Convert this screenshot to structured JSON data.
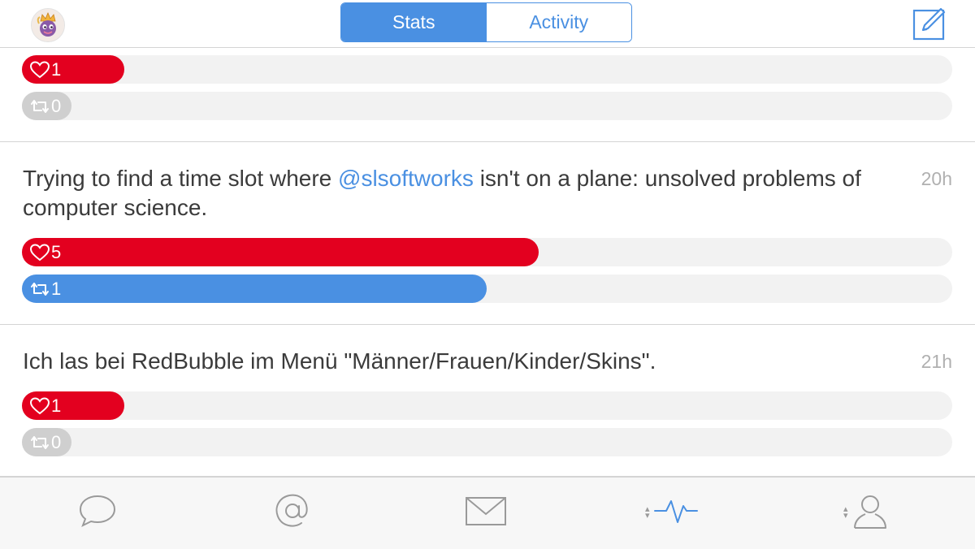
{
  "header": {
    "tabs": [
      {
        "label": "Stats",
        "active": true
      },
      {
        "label": "Activity",
        "active": false
      }
    ]
  },
  "rows": [
    {
      "text": "",
      "time": "",
      "likes": "1",
      "likes_fraction": 0.11,
      "retweets": "0",
      "retweets_fraction": 0.053
    },
    {
      "text_before": "Trying to find a time slot where ",
      "mention": "@slsoftworks",
      "text_after": " isn't on a plane: unsolved problems of computer science.",
      "time": "20h",
      "likes": "5",
      "likes_fraction": 0.555,
      "retweets": "1",
      "retweets_fraction": 0.499
    },
    {
      "text": "Ich las bei RedBubble im Menü \"Männer/Frauen/Kinder/Skins\".",
      "time": "21h",
      "likes": "1",
      "likes_fraction": 0.11,
      "retweets": "0",
      "retweets_fraction": 0.053
    }
  ],
  "tabbar": {
    "items": [
      "speech-bubble-icon",
      "at-sign-icon",
      "envelope-icon",
      "activity-pulse-icon",
      "person-icon"
    ],
    "active": "activity-pulse-icon"
  },
  "colors": {
    "accent": "#4a90e2",
    "like": "#e3001f",
    "inactive_bar": "#cfcfcf",
    "track": "#f2f2f2"
  }
}
